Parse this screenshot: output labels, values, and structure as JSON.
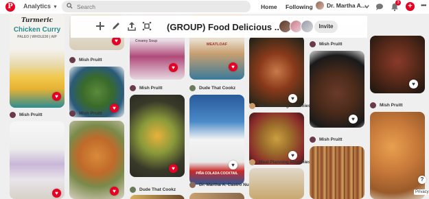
{
  "header": {
    "logo_letter": "P",
    "analytics_label": "Analytics",
    "search_placeholder": "Search",
    "home_label": "Home",
    "following_label": "Following",
    "profile_name": "Dr. Martha A...",
    "notification_count": "3",
    "add_label": "+",
    "more_label": "•••"
  },
  "board": {
    "title": "(GROUP) Food Delicious ...",
    "invite_label": "Invite",
    "collaborator_avatars": [
      "avatar-1",
      "avatar-2",
      "avatar-3"
    ]
  },
  "pins": {
    "col1_top_title_line1": "Turmeric",
    "col1_top_title_line2": "Chicken Curry",
    "col1_top_subtitle": "PALEO | WHOLE30 | AIP",
    "col4_top_title": "Pink Beet Creamy Soup",
    "col5_top_title": "MEATLOAF",
    "col6_mid_title": "PIÑA COLADA COCKTAIL"
  },
  "attributions": {
    "a1": "Mish Pruitt",
    "a2": "Mish Pruitt",
    "a3": "Mish Pruitt",
    "a4": "Mish Pruitt",
    "a5": "Dude That Cookz",
    "a6": "Dude That Cookz",
    "a7": "Dr. Martha A. Castro Nu...",
    "a8": "Meal Planning Mommies",
    "a9": "Meal Planning Mommies",
    "a10": "Mish Pruitt",
    "a11": "Mish Pruitt",
    "a12": "Mish Pruitt",
    "a13": "Mish Pruitt"
  },
  "footer": {
    "help_label": "?",
    "privacy_label": "Privacy"
  },
  "colors": {
    "brand": "#e60023",
    "background": "#efefef"
  }
}
